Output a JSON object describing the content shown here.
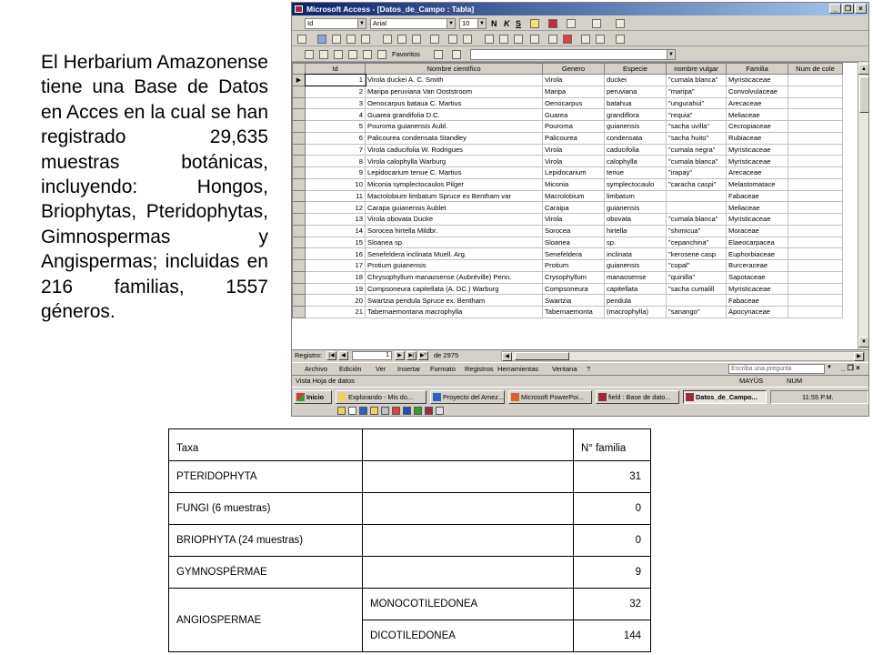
{
  "intro": "El Herbarium Amazonense tiene una Base de Datos en Acces en la cual se han registrado 29,635 muestras botánicas, incluyendo: Hongos, Briophytas, Pteridophytas, Gimnospermas y Angispermas; incluidas en 216 familias, 1557 géneros.",
  "screenshot": {
    "window_title": "Microsoft Access - [Datos_de_Campo : Tabla]",
    "toolbar": {
      "field_combo": "Id",
      "font_combo": "Arial",
      "size_combo": "10",
      "favorites_label": "Favoritos",
      "bold": "N",
      "italic": "K",
      "underline": "S"
    },
    "columns": [
      "Id",
      "Nombre científico",
      "Genero",
      "Especie",
      "nombre vulgar",
      "Familia",
      "Num de cole"
    ],
    "rows": [
      [
        "1",
        "Virola duckei A. C. Smith",
        "Virola",
        "duckei",
        "\"cumala blanca\"",
        "Myristicaceae",
        ""
      ],
      [
        "2",
        "Maripa peruviana Van Ooststroom",
        "Maripa",
        "peruviana",
        "\"maripa\"",
        "Convolvulaceae",
        ""
      ],
      [
        "3",
        "Oenocarpus bataua C. Martius",
        "Oenocarpus",
        "batahua",
        "\"ungurahui\"",
        "Arecaceae",
        ""
      ],
      [
        "4",
        "Guarea grandifolia D.C.",
        "Guarea",
        "grandiflora",
        "\"requia\"",
        "Meliaceae",
        ""
      ],
      [
        "5",
        "Pouroma guianensis Aubl.",
        "Pouroma",
        "guianensis",
        "\"sacha uvilla\"",
        "Cecropiaceae",
        ""
      ],
      [
        "6",
        "Palicourea condensata Standley",
        "Palicourea",
        "condensata",
        "\"sacha huito\"",
        "Rubiaceae",
        ""
      ],
      [
        "7",
        "Virola caducifolia W. Rodrigues",
        "Virola",
        "caducifolia",
        "\"cumala negra\"",
        "Myristicaceae",
        ""
      ],
      [
        "8",
        "Virola calophylla Warburg",
        "Virola",
        "calophylla",
        "\"cumala blanca\"",
        "Myristicaceae",
        ""
      ],
      [
        "9",
        "Lepidocarium tenue C. Martius",
        "Lepidocarium",
        "tenue",
        "\"irapay\"",
        "Arecaceae",
        ""
      ],
      [
        "10",
        "Miconia symplectocaulos Pilger",
        "Miconia",
        "symplectocaulo",
        "\"caracha caspi\"",
        "Melastomatace",
        ""
      ],
      [
        "11",
        "Macrolobium limbatum Spruce ex Bentham var",
        "Macrolobium",
        "limbatum",
        "",
        "Fabaceae",
        ""
      ],
      [
        "12",
        "Carapa guianensis Aublet",
        "Caraipa",
        "guianensis",
        "",
        "Meliaceae",
        ""
      ],
      [
        "13",
        "Virola obovata Ducke",
        "Virola",
        "obovata",
        "\"cumala blanca\"",
        "Myristicaceae",
        ""
      ],
      [
        "14",
        "Sorocea hirtella Mildbr.",
        "Sorocea",
        "hirtella",
        "\"shimicua\"",
        "Moraceae",
        ""
      ],
      [
        "15",
        "Sloanea sp.",
        "Sloanea",
        "sp.",
        "\"cepanchina\"",
        "Elaeocarpacea",
        ""
      ],
      [
        "16",
        "Senefeldera inclinata Muell. Arg.",
        "Senefeldera",
        "inclinata",
        "\"kerosene casp",
        "Euphorbiaceae",
        ""
      ],
      [
        "17",
        "Protium guianensis",
        "Protium",
        "guianensis",
        "\"copal\"",
        "Burceraceae",
        ""
      ],
      [
        "18",
        "Chrysophyllum manaosense (Aubréville) Penn.",
        "Crysophyllum",
        "manaosense",
        "\"quinilla\"",
        "Sapotaceae",
        ""
      ],
      [
        "19",
        "Compsoneura capitellata (A. DC.) Warburg",
        "Compsoneura",
        "capitellata",
        "\"sacha cumalill",
        "Myristicaceae",
        ""
      ],
      [
        "20",
        "Swartzia pendula Spruce ex. Bentham",
        "Swartzia",
        "pendula",
        "",
        "Fabaceae",
        ""
      ],
      [
        "21",
        "Tabernaemontana macrophylla",
        "Tabernaemonta",
        "(macrophylla)",
        "\"sanango\"",
        "Apocynaceae",
        ""
      ]
    ],
    "nav": {
      "label": "Registro:",
      "current": "1",
      "of_text": "de 2975"
    },
    "menu": [
      "Archivo",
      "Edición",
      "Ver",
      "Insertar",
      "Formato",
      "Registros",
      "Herramientas",
      "Ventana",
      "?"
    ],
    "help_placeholder": "Escriba una pregunta",
    "status": {
      "left": "Vista Hoja de datos",
      "caps": "MAYÚS",
      "num": "NUM"
    },
    "taskbar": {
      "start": "Inicio",
      "tasks": [
        "Explorando - Mis do...",
        "Proyecto del Amez...",
        "Microsoft PowerPoi...",
        "field : Base de dato...",
        "Datos_de_Campo..."
      ],
      "clock": "11:55 P.M."
    }
  },
  "taxa_table": {
    "header": {
      "taxa": "Taxa",
      "count": "N° familia"
    },
    "rows": [
      {
        "taxa": "PTERIDOPHYTA",
        "count": "31"
      },
      {
        "taxa": "FUNGI (6 muestras)",
        "count": "0"
      },
      {
        "taxa": "BRIOPHYTA (24 muestras)",
        "count": "0"
      },
      {
        "taxa": "GYMNOSPÉRMAE",
        "count": "9"
      }
    ],
    "angio": {
      "taxa": "ANGIOSPERMAE",
      "sub": [
        {
          "name": "MONOCOTILEDONEA",
          "count": "32"
        },
        {
          "name": "DICOTILEDONEA",
          "count": "144"
        }
      ]
    }
  }
}
